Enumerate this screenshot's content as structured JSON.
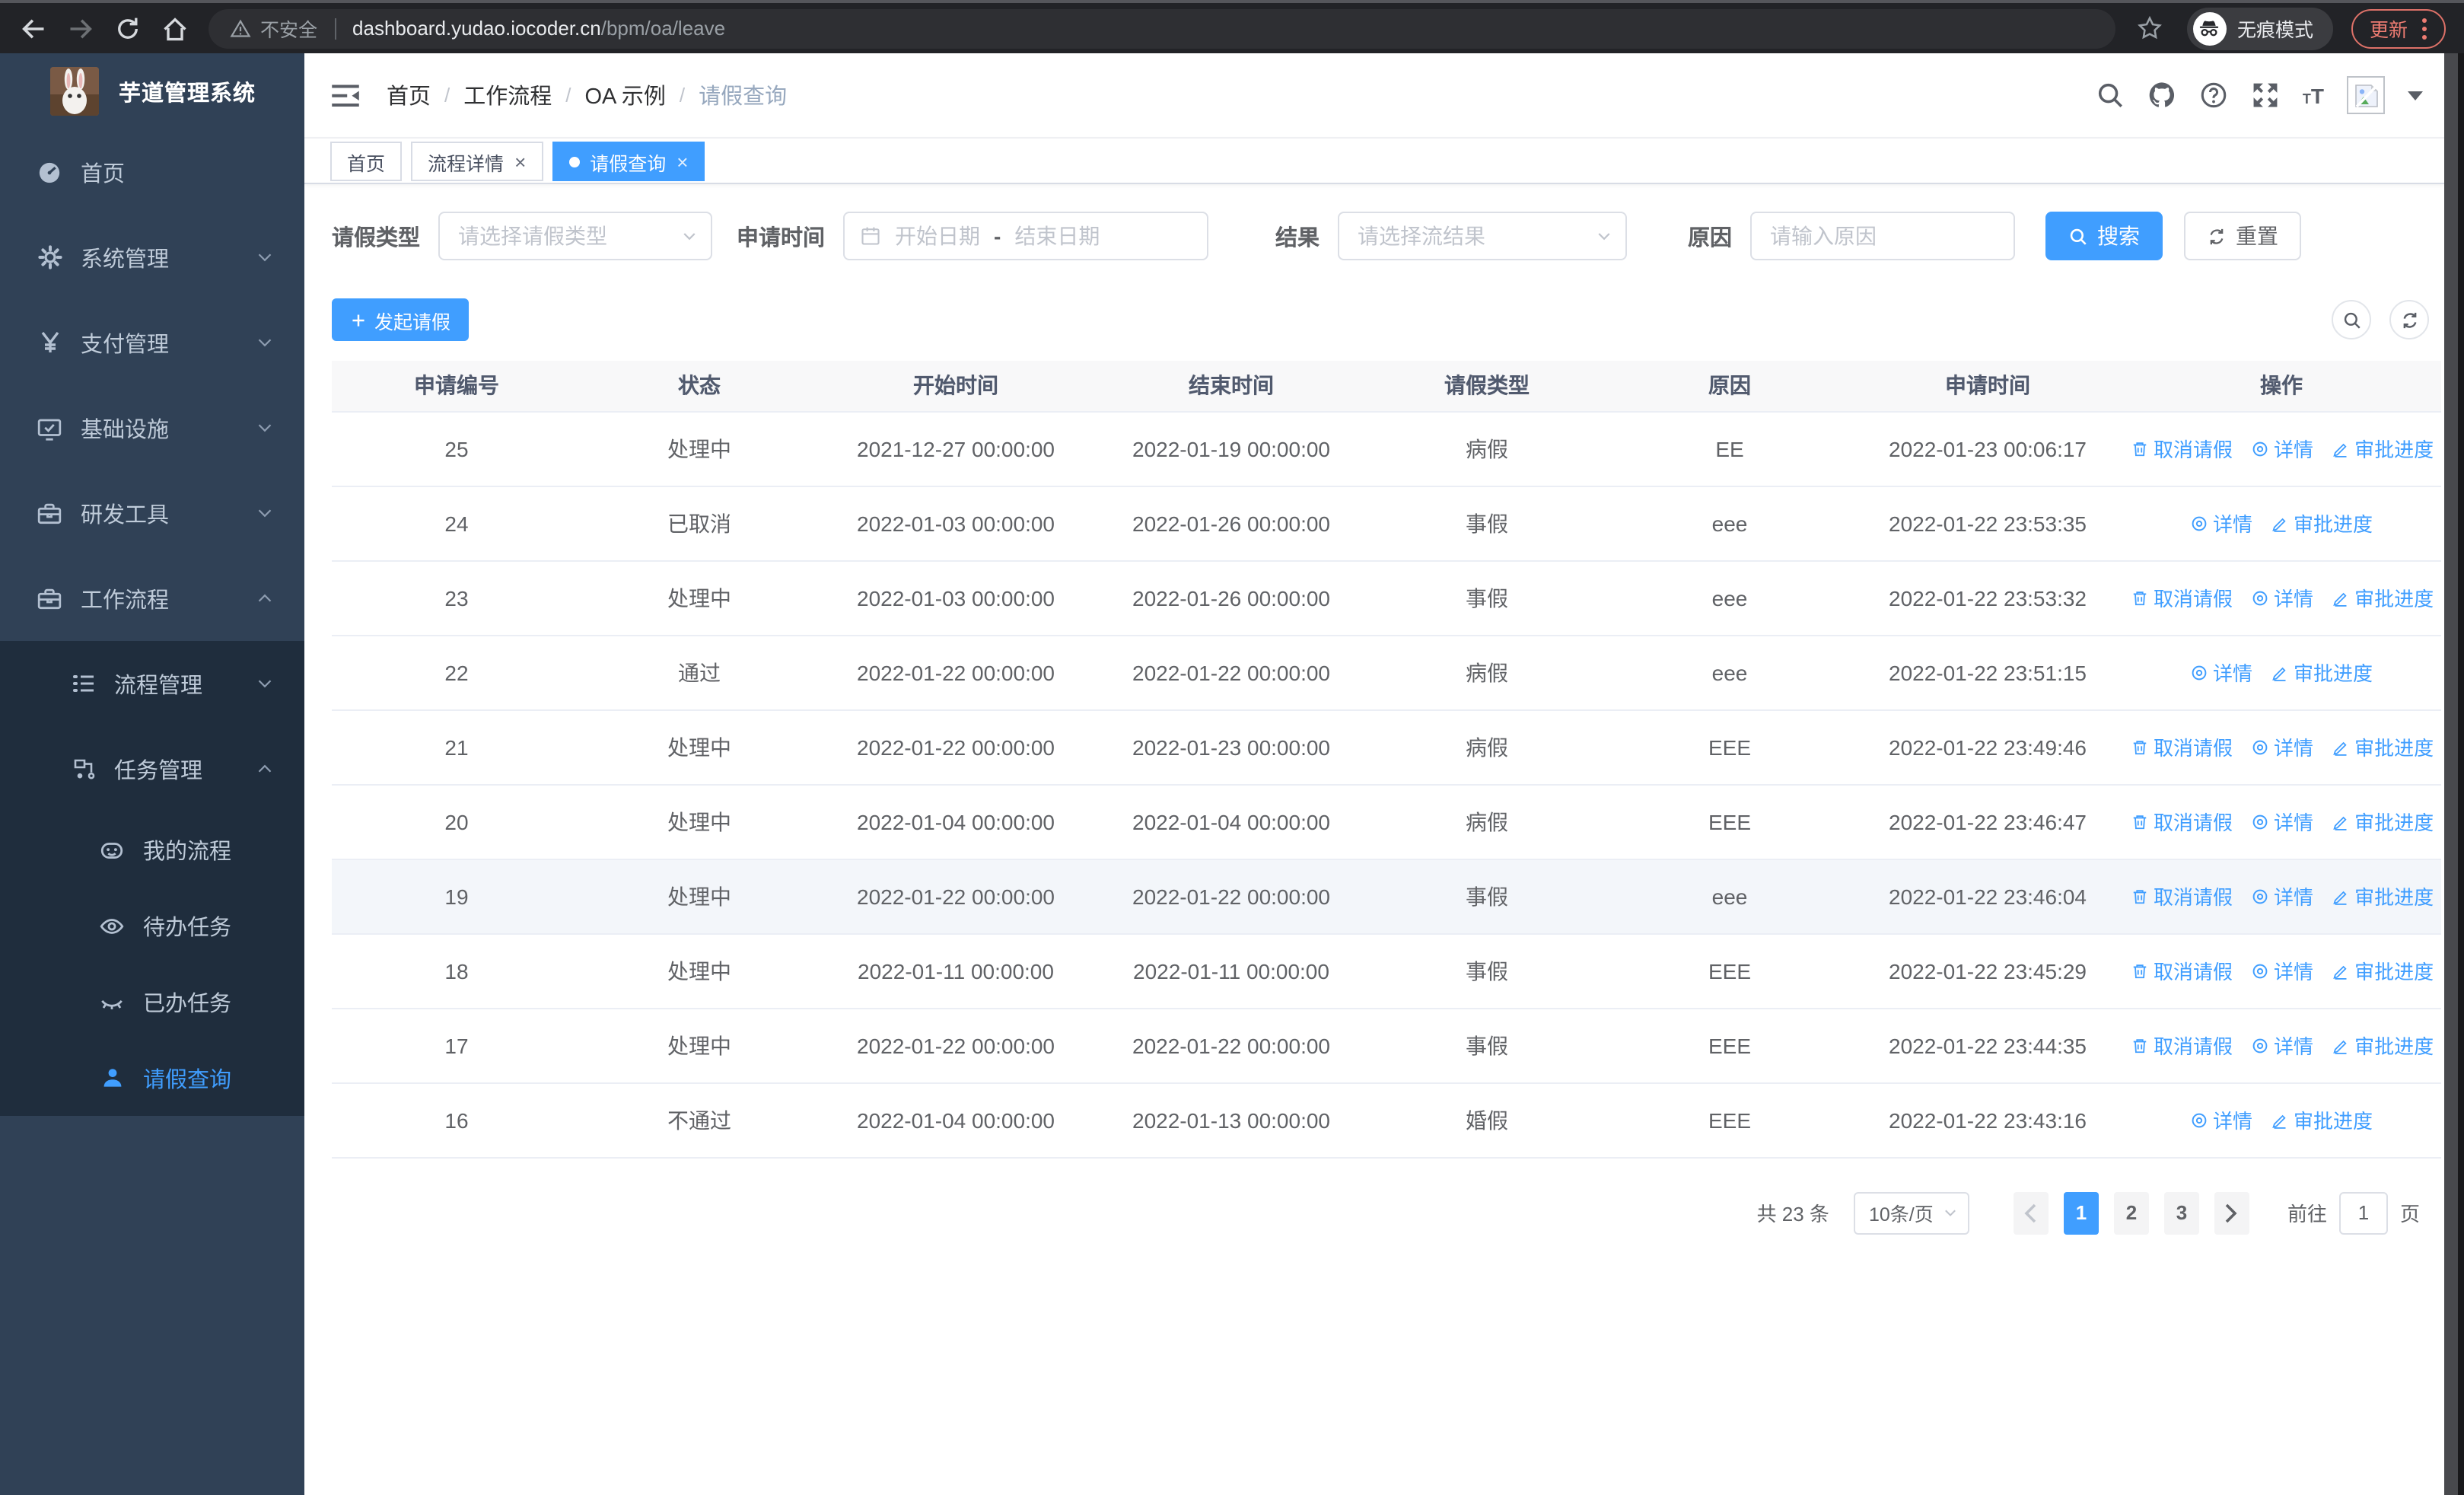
{
  "browser": {
    "security_label": "不安全",
    "url_host": "dashboard.yudao.iocoder.cn",
    "url_path": "/bpm/oa/leave",
    "incognito_label": "无痕模式",
    "update_label": "更新"
  },
  "sidebar": {
    "title": "芋道管理系统",
    "items": [
      {
        "key": "home",
        "label": "首页",
        "icon": "dashboard-icon",
        "arrow": null
      },
      {
        "key": "system",
        "label": "系统管理",
        "icon": "gear-icon",
        "arrow": "down"
      },
      {
        "key": "payment",
        "label": "支付管理",
        "icon": "yen-icon",
        "arrow": "down"
      },
      {
        "key": "infra",
        "label": "基础设施",
        "icon": "monitor-icon",
        "arrow": "down"
      },
      {
        "key": "dev-tools",
        "label": "研发工具",
        "icon": "briefcase-icon",
        "arrow": "down"
      },
      {
        "key": "workflow",
        "label": "工作流程",
        "icon": "briefcase-icon",
        "arrow": "up"
      }
    ],
    "submenu": [
      {
        "key": "process-mgmt",
        "label": "流程管理",
        "icon": "list-icon",
        "arrow": "down",
        "level": 1,
        "active": false
      },
      {
        "key": "task-mgmt",
        "label": "任务管理",
        "icon": "org-icon",
        "arrow": "up",
        "level": 1,
        "active": false
      },
      {
        "key": "my-process",
        "label": "我的流程",
        "icon": "robot-icon",
        "arrow": null,
        "level": 2,
        "active": false
      },
      {
        "key": "todo-tasks",
        "label": "待办任务",
        "icon": "eye-icon",
        "arrow": null,
        "level": 2,
        "active": false
      },
      {
        "key": "done-tasks",
        "label": "已办任务",
        "icon": "eye-closed-icon",
        "arrow": null,
        "level": 2,
        "active": false
      },
      {
        "key": "leave-query",
        "label": "请假查询",
        "icon": "user-icon",
        "arrow": null,
        "level": 2,
        "active": true
      }
    ]
  },
  "header": {
    "breadcrumb": [
      "首页",
      "工作流程",
      "OA 示例",
      "请假查询"
    ]
  },
  "tabs": [
    {
      "key": "home",
      "label": "首页",
      "closable": false,
      "active": false
    },
    {
      "key": "process-detail",
      "label": "流程详情",
      "closable": true,
      "active": false
    },
    {
      "key": "leave-query",
      "label": "请假查询",
      "closable": true,
      "active": true
    }
  ],
  "filters": {
    "leave_type": {
      "label": "请假类型",
      "placeholder": "请选择请假类型"
    },
    "apply_time": {
      "label": "申请时间",
      "start_placeholder": "开始日期",
      "separator": "-",
      "end_placeholder": "结束日期"
    },
    "result": {
      "label": "结果",
      "placeholder": "请选择流结果"
    },
    "reason": {
      "label": "原因",
      "placeholder": "请输入原因"
    },
    "search_label": "搜索",
    "reset_label": "重置"
  },
  "toolbar": {
    "create_label": "发起请假"
  },
  "table": {
    "columns": [
      "申请编号",
      "状态",
      "开始时间",
      "结束时间",
      "请假类型",
      "原因",
      "申请时间",
      "操作"
    ],
    "action_labels": {
      "cancel": "取消请假",
      "detail": "详情",
      "progress": "审批进度"
    },
    "rows": [
      {
        "id": "25",
        "status": "处理中",
        "start": "2021-12-27 00:00:00",
        "end": "2022-01-19 00:00:00",
        "type": "病假",
        "reason": "EE",
        "apply": "2022-01-23 00:06:17",
        "actions": [
          "cancel",
          "detail",
          "progress"
        ],
        "hover": false
      },
      {
        "id": "24",
        "status": "已取消",
        "start": "2022-01-03 00:00:00",
        "end": "2022-01-26 00:00:00",
        "type": "事假",
        "reason": "eee",
        "apply": "2022-01-22 23:53:35",
        "actions": [
          "detail",
          "progress"
        ],
        "hover": false
      },
      {
        "id": "23",
        "status": "处理中",
        "start": "2022-01-03 00:00:00",
        "end": "2022-01-26 00:00:00",
        "type": "事假",
        "reason": "eee",
        "apply": "2022-01-22 23:53:32",
        "actions": [
          "cancel",
          "detail",
          "progress"
        ],
        "hover": false
      },
      {
        "id": "22",
        "status": "通过",
        "start": "2022-01-22 00:00:00",
        "end": "2022-01-22 00:00:00",
        "type": "病假",
        "reason": "eee",
        "apply": "2022-01-22 23:51:15",
        "actions": [
          "detail",
          "progress"
        ],
        "hover": false
      },
      {
        "id": "21",
        "status": "处理中",
        "start": "2022-01-22 00:00:00",
        "end": "2022-01-23 00:00:00",
        "type": "病假",
        "reason": "EEE",
        "apply": "2022-01-22 23:49:46",
        "actions": [
          "cancel",
          "detail",
          "progress"
        ],
        "hover": false
      },
      {
        "id": "20",
        "status": "处理中",
        "start": "2022-01-04 00:00:00",
        "end": "2022-01-04 00:00:00",
        "type": "病假",
        "reason": "EEE",
        "apply": "2022-01-22 23:46:47",
        "actions": [
          "cancel",
          "detail",
          "progress"
        ],
        "hover": false
      },
      {
        "id": "19",
        "status": "处理中",
        "start": "2022-01-22 00:00:00",
        "end": "2022-01-22 00:00:00",
        "type": "事假",
        "reason": "eee",
        "apply": "2022-01-22 23:46:04",
        "actions": [
          "cancel",
          "detail",
          "progress"
        ],
        "hover": true
      },
      {
        "id": "18",
        "status": "处理中",
        "start": "2022-01-11 00:00:00",
        "end": "2022-01-11 00:00:00",
        "type": "事假",
        "reason": "EEE",
        "apply": "2022-01-22 23:45:29",
        "actions": [
          "cancel",
          "detail",
          "progress"
        ],
        "hover": false
      },
      {
        "id": "17",
        "status": "处理中",
        "start": "2022-01-22 00:00:00",
        "end": "2022-01-22 00:00:00",
        "type": "事假",
        "reason": "EEE",
        "apply": "2022-01-22 23:44:35",
        "actions": [
          "cancel",
          "detail",
          "progress"
        ],
        "hover": false
      },
      {
        "id": "16",
        "status": "不通过",
        "start": "2022-01-04 00:00:00",
        "end": "2022-01-13 00:00:00",
        "type": "婚假",
        "reason": "EEE",
        "apply": "2022-01-22 23:43:16",
        "actions": [
          "detail",
          "progress"
        ],
        "hover": false
      }
    ]
  },
  "pagination": {
    "total_label": "共 23 条",
    "page_size": "10条/页",
    "pages": [
      "1",
      "2",
      "3"
    ],
    "active_page": "1",
    "goto_label": "前往",
    "goto_value": "1",
    "unit_label": "页"
  },
  "colors": {
    "accent": "#409eff",
    "sidebar_bg": "#304156",
    "submenu_bg": "#1f2d3d",
    "sidebar_text": "#bfcbd9",
    "update_accent": "#ee7c72",
    "table_border": "#ebeef5",
    "header_bg": "#f8f8f9"
  }
}
